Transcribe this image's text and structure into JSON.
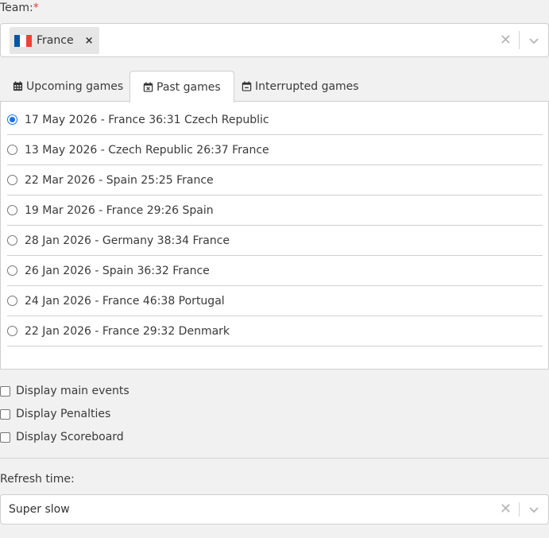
{
  "team": {
    "label": "Team:",
    "required_mark": "*",
    "selected_chip": "France",
    "flag_colors": [
      "#0055a4",
      "#ffffff",
      "#ef4135"
    ],
    "remove_icon": "×",
    "clear_icon": "✕"
  },
  "tabs": [
    {
      "label": "Upcoming games",
      "icon": "calendar-icon",
      "active": false
    },
    {
      "label": "Past games",
      "icon": "calendar-x-icon",
      "active": true
    },
    {
      "label": "Interrupted games",
      "icon": "calendar-minus-icon",
      "active": false
    }
  ],
  "games": [
    {
      "text": "17 May 2026 - France 36:31 Czech Republic",
      "selected": true
    },
    {
      "text": "13 May 2026 - Czech Republic 26:37 France",
      "selected": false
    },
    {
      "text": "22 Mar 2026 - Spain 25:25 France",
      "selected": false
    },
    {
      "text": "19 Mar 2026 - France 29:26 Spain",
      "selected": false
    },
    {
      "text": "28 Jan 2026 - Germany 38:34 France",
      "selected": false
    },
    {
      "text": "26 Jan 2026 - Spain 36:32 France",
      "selected": false
    },
    {
      "text": "24 Jan 2026 - France 46:38 Portugal",
      "selected": false
    },
    {
      "text": "22 Jan 2026 - France 29:32 Denmark",
      "selected": false
    }
  ],
  "options": [
    {
      "label": "Display main events",
      "checked": false
    },
    {
      "label": "Display Penalties",
      "checked": false
    },
    {
      "label": "Display Scoreboard",
      "checked": false
    }
  ],
  "refresh": {
    "label": "Refresh time:",
    "value": "Super slow",
    "clear_icon": "✕"
  },
  "colors": {
    "accent": "#1a73e8",
    "required": "#e0393e",
    "background": "#f1f1f2"
  }
}
